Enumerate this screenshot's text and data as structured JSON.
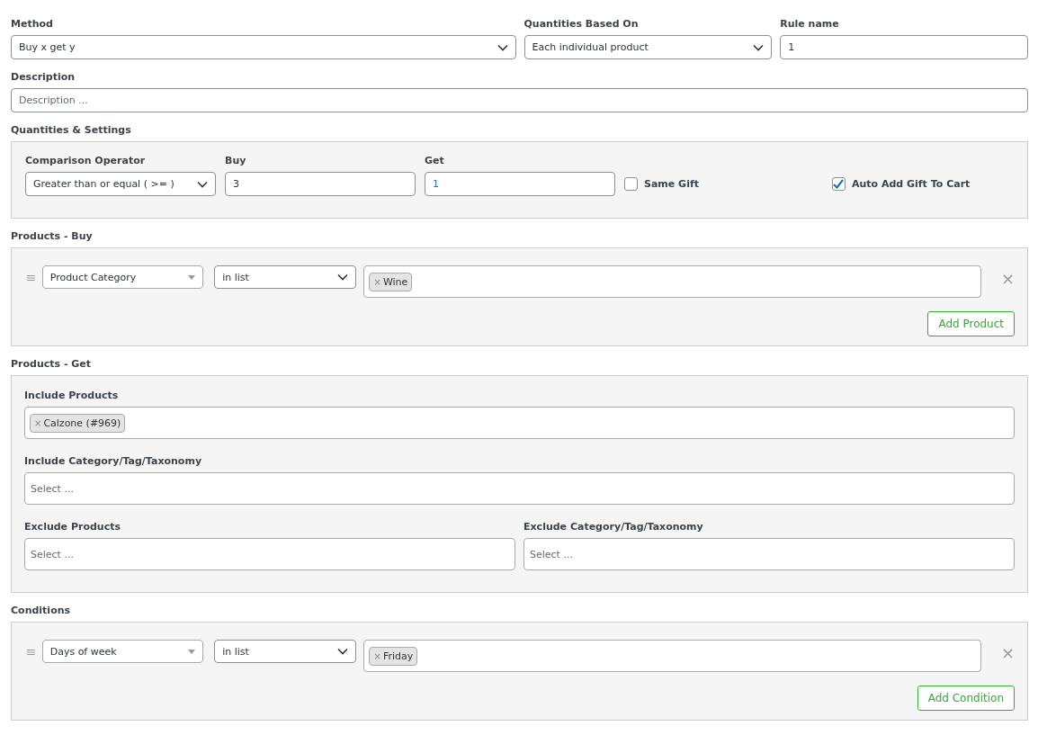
{
  "method": {
    "label": "Method",
    "value": "Buy x get y"
  },
  "quantities_based_on": {
    "label": "Quantities Based On",
    "value": "Each individual product"
  },
  "rule_name": {
    "label": "Rule name",
    "value": "1"
  },
  "description": {
    "label": "Description",
    "placeholder": "Description ..."
  },
  "quantities_settings": {
    "title": "Quantities & Settings",
    "comparison_operator": {
      "label": "Comparison Operator",
      "value": "Greater than or equal ( >= )"
    },
    "buy": {
      "label": "Buy",
      "value": "3"
    },
    "get": {
      "label": "Get",
      "value": "1"
    },
    "checkboxes": [
      {
        "label": "Same Gift",
        "checked": false
      },
      {
        "label": "Auto Add Gift To Cart",
        "checked": true
      }
    ]
  },
  "products_buy": {
    "title": "Products - Buy",
    "rules": [
      {
        "field": "Product Category",
        "operator": "in list",
        "tags": [
          {
            "remove": "×",
            "label": "Wine"
          }
        ],
        "remove": "×"
      }
    ],
    "button": "Add Product"
  },
  "products_get": {
    "title": "Products - Get",
    "include_products": {
      "label": "Include Products",
      "tags": [
        {
          "remove": "×",
          "label": "Calzone (#969)"
        }
      ]
    },
    "include_category": {
      "label": "Include Category/Tag/Taxonomy",
      "placeholder": "Select ..."
    },
    "exclude_products": {
      "label": "Exclude Products",
      "placeholder": "Select ..."
    },
    "exclude_category": {
      "label": "Exclude Category/Tag/Taxonomy",
      "placeholder": "Select ..."
    }
  },
  "conditions": {
    "title": "Conditions",
    "rules": [
      {
        "field": "Days of week",
        "operator": "in list",
        "tags": [
          {
            "remove": "×",
            "label": "Friday"
          }
        ],
        "remove": "×"
      }
    ],
    "button": "Add Condition"
  }
}
